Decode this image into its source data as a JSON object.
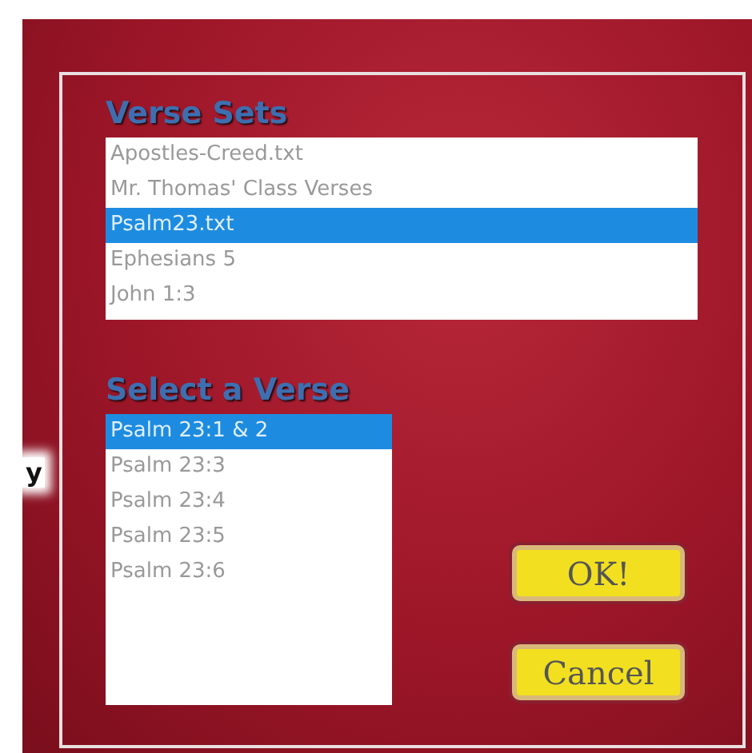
{
  "side_text": "y",
  "verse_sets": {
    "title": "Verse Sets",
    "items": [
      {
        "label": "Apostles-Creed.txt",
        "selected": false
      },
      {
        "label": "Mr. Thomas' Class Verses",
        "selected": false
      },
      {
        "label": "Psalm23.txt",
        "selected": true
      },
      {
        "label": "Ephesians 5",
        "selected": false
      },
      {
        "label": "John 1:3",
        "selected": false
      }
    ]
  },
  "verses": {
    "title": "Select a Verse",
    "items": [
      {
        "label": "Psalm 23:1 & 2",
        "selected": true
      },
      {
        "label": "Psalm 23:3",
        "selected": false
      },
      {
        "label": "Psalm 23:4",
        "selected": false
      },
      {
        "label": "Psalm 23:5",
        "selected": false
      },
      {
        "label": "Psalm 23:6",
        "selected": false
      }
    ]
  },
  "buttons": [
    "OK!",
    "Cancel"
  ]
}
